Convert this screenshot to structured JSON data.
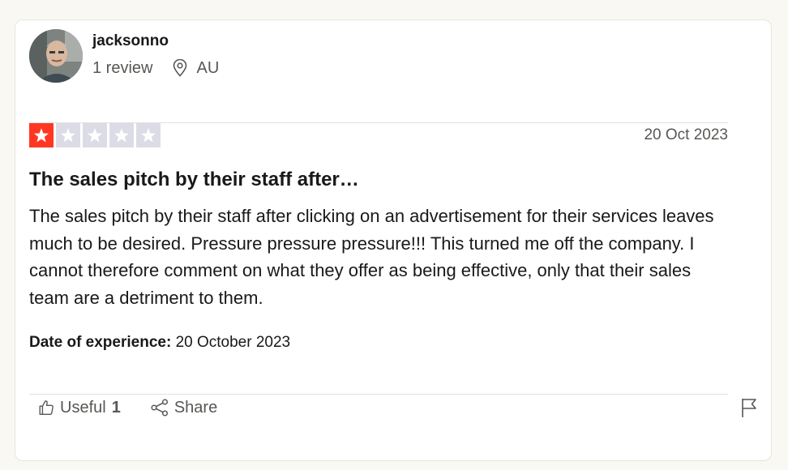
{
  "consumer": {
    "name": "jacksonno",
    "review_count": "1 review",
    "location": "AU"
  },
  "review": {
    "rating": 1,
    "max_rating": 5,
    "date": "20 Oct 2023",
    "title": "The sales pitch by their staff after…",
    "body": "The sales pitch by their staff after clicking on an advertisement for their services leaves much to be desired. Pressure pressure pressure!!! This turned me off the company. I cannot therefore comment on what they offer as being effective, only that their sales team are a detriment to them.",
    "experience_label": "Date of experience:",
    "experience_date": "20 October 2023"
  },
  "actions": {
    "useful_label": "Useful",
    "useful_count": "1",
    "share_label": "Share"
  },
  "colors": {
    "star_filled": "#ff3722",
    "star_empty": "#dcdce6",
    "background": "#f9f8f3"
  },
  "icons": {
    "location": "location-pin-icon",
    "useful": "thumbs-up-icon",
    "share": "share-icon",
    "flag": "flag-icon",
    "star": "star-icon"
  }
}
